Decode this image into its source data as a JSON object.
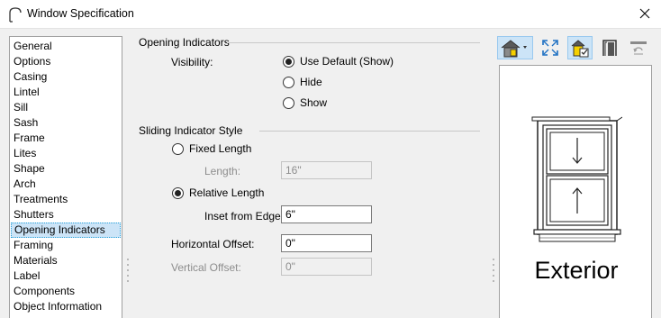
{
  "window": {
    "title": "Window Specification"
  },
  "sidebar": {
    "items": [
      {
        "label": "General",
        "selected": false
      },
      {
        "label": "Options",
        "selected": false
      },
      {
        "label": "Casing",
        "selected": false
      },
      {
        "label": "Lintel",
        "selected": false
      },
      {
        "label": "Sill",
        "selected": false
      },
      {
        "label": "Sash",
        "selected": false
      },
      {
        "label": "Frame",
        "selected": false
      },
      {
        "label": "Lites",
        "selected": false
      },
      {
        "label": "Shape",
        "selected": false
      },
      {
        "label": "Arch",
        "selected": false
      },
      {
        "label": "Treatments",
        "selected": false
      },
      {
        "label": "Shutters",
        "selected": false
      },
      {
        "label": "Opening Indicators",
        "selected": true
      },
      {
        "label": "Framing",
        "selected": false
      },
      {
        "label": "Materials",
        "selected": false
      },
      {
        "label": "Label",
        "selected": false
      },
      {
        "label": "Components",
        "selected": false
      },
      {
        "label": "Object Information",
        "selected": false
      }
    ]
  },
  "opening_indicators": {
    "group_title": "Opening Indicators",
    "visibility_label": "Visibility:",
    "options": [
      {
        "label": "Use Default (Show)",
        "checked": true
      },
      {
        "label": "Hide",
        "checked": false
      },
      {
        "label": "Show",
        "checked": false
      }
    ]
  },
  "sliding_indicator": {
    "group_title": "Sliding Indicator Style",
    "fixed_length_label": "Fixed Length",
    "fixed_length_checked": false,
    "length_label": "Length:",
    "length_value": "16\"",
    "relative_length_label": "Relative Length",
    "relative_length_checked": true,
    "inset_label": "Inset from Edge:",
    "inset_value": "6\"",
    "horizontal_offset_label": "Horizontal Offset:",
    "horizontal_offset_value": "0\"",
    "vertical_offset_label": "Vertical Offset:",
    "vertical_offset_value": "0\""
  },
  "preview": {
    "view_label": "Exterior"
  },
  "colors": {
    "accent": "#0078d7",
    "selection": "#cce4f7",
    "disabled_text": "#8d8d8d"
  }
}
